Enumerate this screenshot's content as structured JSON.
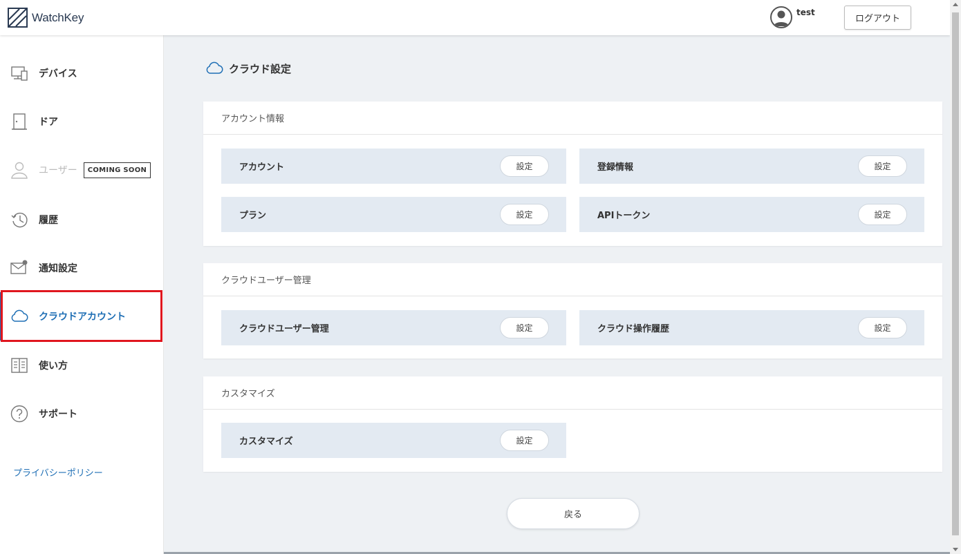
{
  "header": {
    "logo_text": "WatchKey",
    "user_name": "test",
    "logout_label": "ログアウト"
  },
  "sidebar": {
    "items": [
      {
        "label": "デバイス",
        "icon": "device-icon"
      },
      {
        "label": "ドア",
        "icon": "door-icon"
      },
      {
        "label": "ユーザー",
        "icon": "user-icon",
        "badge": "COMING SOON",
        "disabled": true
      },
      {
        "label": "履歴",
        "icon": "history-icon"
      },
      {
        "label": "通知設定",
        "icon": "mail-icon"
      },
      {
        "label": "クラウドアカウント",
        "icon": "cloud-icon",
        "active": true
      },
      {
        "label": "使い方",
        "icon": "book-icon"
      },
      {
        "label": "サポート",
        "icon": "help-icon"
      }
    ],
    "privacy_link": "プライバシーポリシー"
  },
  "main": {
    "title": "クラウド設定",
    "sections": [
      {
        "header": "アカウント情報",
        "items": [
          {
            "label": "アカウント",
            "button": "設定"
          },
          {
            "label": "登録情報",
            "button": "設定"
          },
          {
            "label": "プラン",
            "button": "設定"
          },
          {
            "label": "APIトークン",
            "button": "設定"
          }
        ]
      },
      {
        "header": "クラウドユーザー管理",
        "items": [
          {
            "label": "クラウドユーザー管理",
            "button": "設定"
          },
          {
            "label": "クラウド操作履歴",
            "button": "設定"
          }
        ]
      },
      {
        "header": "カスタマイズ",
        "items": [
          {
            "label": "カスタマイズ",
            "button": "設定"
          }
        ]
      }
    ],
    "back_label": "戻る"
  },
  "colors": {
    "accent": "#1f6fb5",
    "highlight": "#e0161e",
    "row_bg": "#e3eaf2",
    "page_bg": "#eef1f4"
  }
}
